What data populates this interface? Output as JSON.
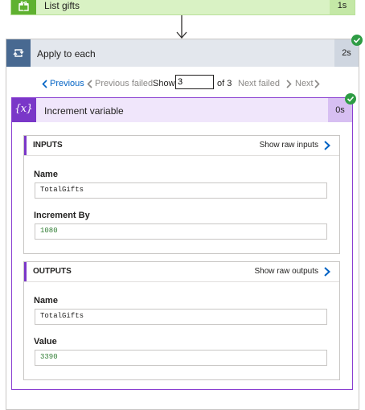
{
  "top_action": {
    "title": "List gifts",
    "duration": "1s"
  },
  "loop": {
    "title": "Apply to each",
    "duration": "2s"
  },
  "pager": {
    "previous_label": "Previous",
    "previous_failed_label": "Previous failed",
    "show_label": "Show",
    "current_value": "3",
    "of_label": "of 3",
    "next_failed_label": "Next failed",
    "next_label": "Next"
  },
  "step": {
    "icon_text": "{x}",
    "title": "Increment variable",
    "duration": "0s",
    "inputs": {
      "heading": "INPUTS",
      "raw_link": "Show raw inputs",
      "name_label": "Name",
      "name_value": "TotalGifts",
      "increment_label": "Increment By",
      "increment_value": "1080"
    },
    "outputs": {
      "heading": "OUTPUTS",
      "raw_link": "Show raw outputs",
      "name_label": "Name",
      "name_value": "TotalGifts",
      "value_label": "Value",
      "value_value": "3390"
    }
  },
  "colors": {
    "success": "#2e9c44",
    "loop_accent": "#486991",
    "variable_accent": "#7a37c8",
    "link": "#0062c4"
  }
}
